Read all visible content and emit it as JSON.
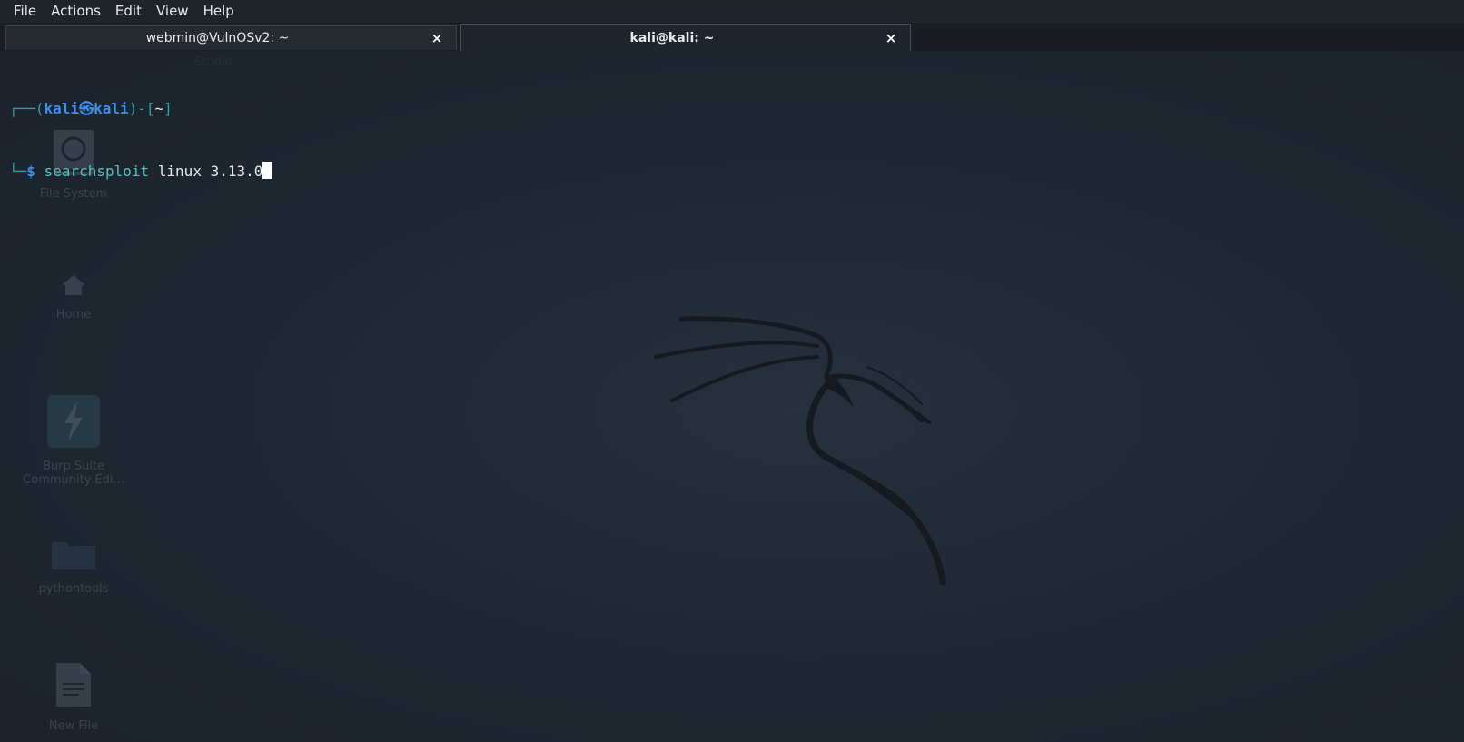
{
  "menu": [
    "File",
    "Actions",
    "Edit",
    "View",
    "Help"
  ],
  "tabs": [
    {
      "title": "webmin@VulnOSv2: ~",
      "close": "×",
      "active": false
    },
    {
      "title": "kali@kali: ~",
      "close": "×",
      "active": true
    }
  ],
  "terminal": {
    "prompt_open": "┌──(",
    "user": "kali",
    "at_symbol": "㉿",
    "host": "kali",
    "prompt_mid": ")-[",
    "cwd": "~",
    "prompt_close": "]",
    "prompt_line2": "└─",
    "dollar": "$",
    "command": "searchsploit",
    "args": "linux 3.13.0"
  },
  "desktop_icons": [
    {
      "label": "File System",
      "icon": "drive-icon"
    },
    {
      "label": "Home",
      "icon": "home-icon"
    },
    {
      "label": "Burp Suite Community Edi...",
      "icon": "burp-icon"
    },
    {
      "label": "pythontools",
      "icon": "folder-icon"
    },
    {
      "label": "New File",
      "icon": "file-icon"
    }
  ],
  "ghost_text": "Studio",
  "colors": {
    "prompt_frame": "#2f9fa6",
    "prompt_user": "#3d8ff0",
    "command": "#52c2c0",
    "background": "#1d2530"
  }
}
